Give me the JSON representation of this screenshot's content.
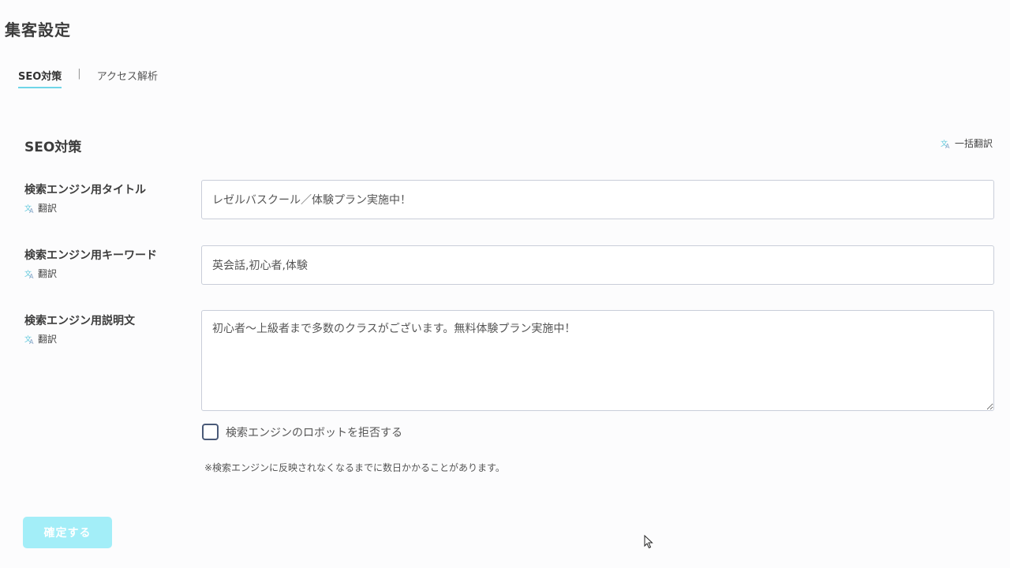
{
  "page": {
    "title": "集客設定"
  },
  "tabs": [
    {
      "label": "SEO対策",
      "active": true
    },
    {
      "label": "アクセス解析",
      "active": false
    }
  ],
  "tab_separator": "|",
  "section": {
    "title": "SEO対策",
    "bulk_translate_label": "一括翻訳"
  },
  "fields": {
    "title": {
      "label": "検索エンジン用タイトル",
      "translate_label": "翻訳",
      "value": "レゼルバスクール／体験プラン実施中！"
    },
    "keywords": {
      "label": "検索エンジン用キーワード",
      "translate_label": "翻訳",
      "value": "英会話,初心者,体験"
    },
    "description": {
      "label": "検索エンジン用説明文",
      "translate_label": "翻訳",
      "value": "初心者〜上級者まで多数のクラスがございます。無料体験プラン実施中！"
    }
  },
  "robots_checkbox": {
    "label": "検索エンジンのロボットを拒否する",
    "checked": false
  },
  "note": "※検索エンジンに反映されなくなるまでに数日かかることがあります。",
  "confirm_button": {
    "label": "確定する"
  },
  "colors": {
    "accent": "#6fd6e8",
    "button_bg": "#a3eef8",
    "field_border": "#c9ced9",
    "checkbox_border": "#4a5a78"
  },
  "icons": {
    "translate": "translate-icon",
    "cursor": "mouse-pointer-icon"
  }
}
